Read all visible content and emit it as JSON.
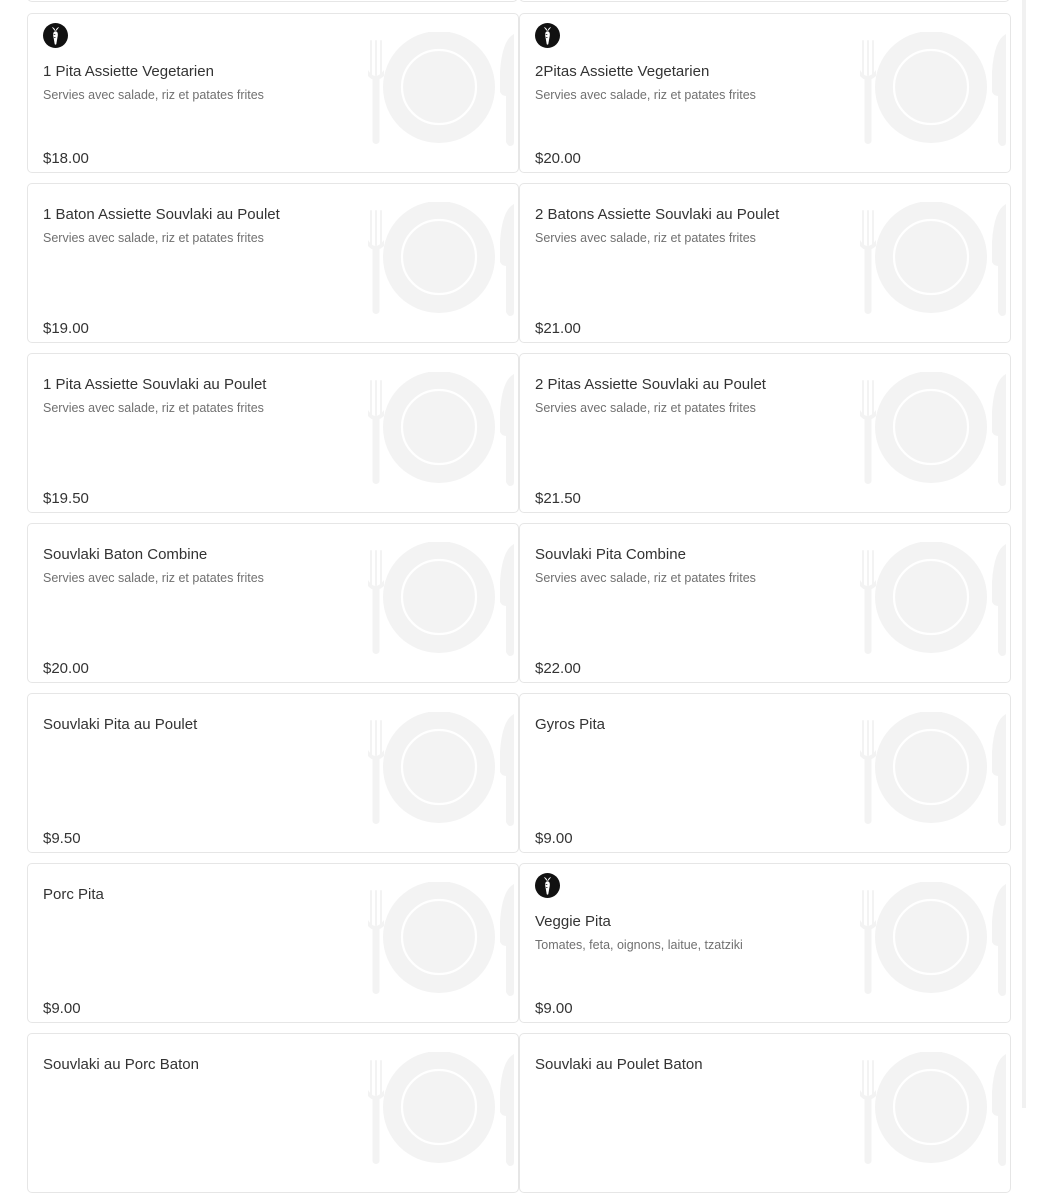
{
  "menu": {
    "items": [
      {
        "name": "1 Pita Assiette Vegetarien",
        "description": "Servies avec salade, riz et patates frites",
        "price": "$18.00",
        "vegetarian": true,
        "icon": "vegetarian-carrot-icon"
      },
      {
        "name": "2Pitas Assiette Vegetarien",
        "description": "Servies avec salade, riz et patates frites",
        "price": "$20.00",
        "vegetarian": true,
        "icon": "vegetarian-carrot-icon"
      },
      {
        "name": "1 Baton Assiette Souvlaki au Poulet",
        "description": "Servies avec salade, riz et patates frites",
        "price": "$19.00",
        "vegetarian": false
      },
      {
        "name": "2 Batons Assiette Souvlaki au Poulet",
        "description": "Servies avec salade, riz et patates frites",
        "price": "$21.00",
        "vegetarian": false
      },
      {
        "name": "1 Pita Assiette Souvlaki au Poulet",
        "description": "Servies avec salade, riz et patates frites",
        "price": "$19.50",
        "vegetarian": false
      },
      {
        "name": "2 Pitas Assiette Souvlaki au Poulet",
        "description": "Servies avec salade, riz et patates frites",
        "price": "$21.50",
        "vegetarian": false
      },
      {
        "name": "Souvlaki Baton Combine",
        "description": "Servies avec salade, riz et patates frites",
        "price": "$20.00",
        "vegetarian": false
      },
      {
        "name": "Souvlaki Pita Combine",
        "description": "Servies avec salade, riz et patates frites",
        "price": "$22.00",
        "vegetarian": false
      },
      {
        "name": "Souvlaki Pita au Poulet",
        "description": "",
        "price": "$9.50",
        "vegetarian": false
      },
      {
        "name": "Gyros Pita",
        "description": "",
        "price": "$9.00",
        "vegetarian": false
      },
      {
        "name": "Porc Pita",
        "description": "",
        "price": "$9.00",
        "vegetarian": false
      },
      {
        "name": "Veggie Pita",
        "description": "Tomates, feta, oignons, laitue, tzatziki",
        "price": "$9.00",
        "vegetarian": true,
        "icon": "vegetarian-carrot-icon"
      },
      {
        "name": "Souvlaki au Porc Baton",
        "description": "",
        "price": "",
        "vegetarian": false
      },
      {
        "name": "Souvlaki au Poulet Baton",
        "description": "",
        "price": "",
        "vegetarian": false
      }
    ],
    "placeholder_icon": "plate-fork-knife-icon"
  }
}
